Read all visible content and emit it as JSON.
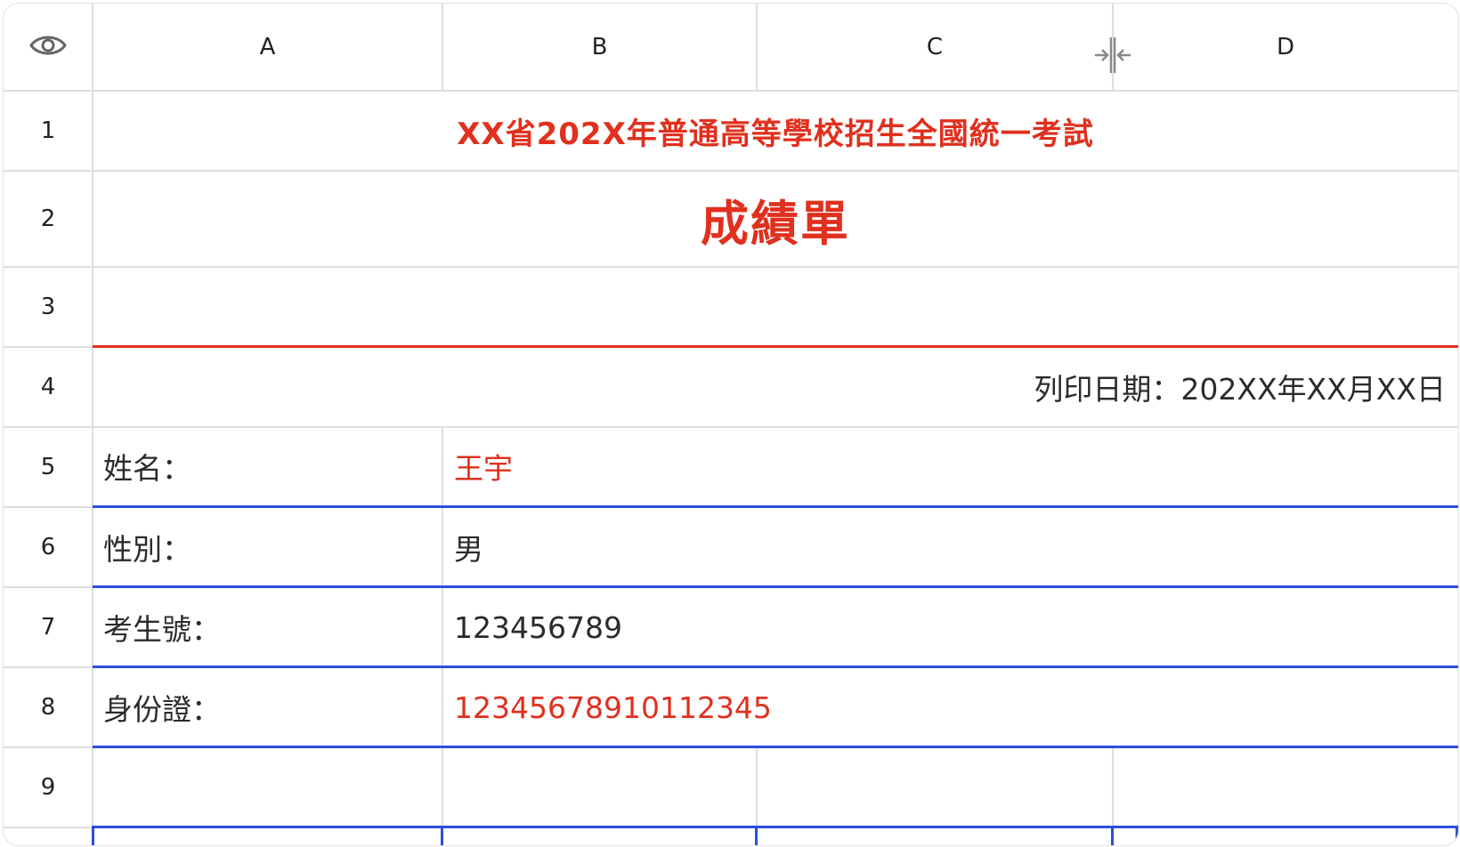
{
  "columns": [
    "A",
    "B",
    "C",
    "D"
  ],
  "rows": [
    "1",
    "2",
    "3",
    "4",
    "5",
    "6",
    "7",
    "8",
    "9"
  ],
  "cells": {
    "r1": "XX省202X年普通高等學校招生全國統一考試",
    "r2": "成績單",
    "r4": "列印日期：202XX年XX月XX日",
    "name_label": "姓名：",
    "name_value": "王宇",
    "gender_label": "性別：",
    "gender_value": "男",
    "exam_label": "考生號：",
    "exam_value": "123456789",
    "id_label": "身份證：",
    "id_value": "12345678910112345"
  },
  "icons": {
    "header_corner": "eye-icon",
    "column_resize": "column-resize-icon"
  },
  "colors": {
    "accent_red": "#e0301e",
    "border_blue": "#2b4fe0",
    "grid": "#dedede"
  }
}
